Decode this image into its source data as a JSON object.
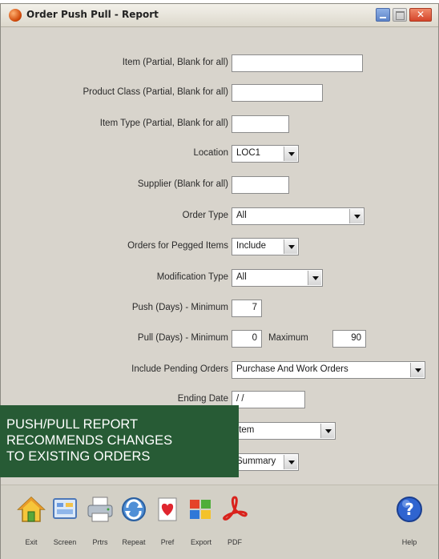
{
  "window": {
    "title": "Order Push Pull - Report"
  },
  "form": {
    "item": {
      "label": "Item (Partial, Blank for all)",
      "value": ""
    },
    "product_class": {
      "label": "Product Class (Partial, Blank for all)",
      "value": ""
    },
    "item_type": {
      "label": "Item Type (Partial, Blank for all)",
      "value": ""
    },
    "location": {
      "label": "Location",
      "value": "LOC1"
    },
    "supplier": {
      "label": "Supplier (Blank for all)",
      "value": ""
    },
    "order_type": {
      "label": "Order Type",
      "value": "All"
    },
    "pegged_items": {
      "label": "Orders for Pegged Items",
      "value": "Include"
    },
    "modification_type": {
      "label": "Modification Type",
      "value": "All"
    },
    "push_days": {
      "label": "Push (Days) - Minimum",
      "value": "7"
    },
    "pull_days": {
      "label": "Pull (Days) - Minimum",
      "min": "0",
      "max_label": "Maximum",
      "max": "90"
    },
    "pending_orders": {
      "label": "Include Pending Orders",
      "value": "Purchase And Work Orders"
    },
    "ending_date": {
      "label": "Ending Date",
      "value": "/ /"
    },
    "sort_by": {
      "value": "Item"
    },
    "detail": {
      "value": "Summary"
    }
  },
  "overlay": {
    "lines": [
      "PUSH/PULL REPORT",
      "RECOMMENDS CHANGES",
      "TO EXISTING ORDERS"
    ]
  },
  "toolbar": {
    "buttons": [
      {
        "label": "Exit",
        "icon": "home-icon"
      },
      {
        "label": "Screen",
        "icon": "screen-icon"
      },
      {
        "label": "Prtrs",
        "icon": "printer-icon"
      },
      {
        "label": "Repeat",
        "icon": "repeat-icon"
      },
      {
        "label": "Pref",
        "icon": "preferences-icon"
      },
      {
        "label": "Export",
        "icon": "export-icon"
      },
      {
        "label": "PDF",
        "icon": "pdf-icon"
      },
      {
        "label": "Help",
        "icon": "help-icon"
      }
    ]
  },
  "colors": {
    "window_bg": "#d8d4cc",
    "overlay_bg": "#275b35",
    "overlay_text": "#ffffff"
  }
}
